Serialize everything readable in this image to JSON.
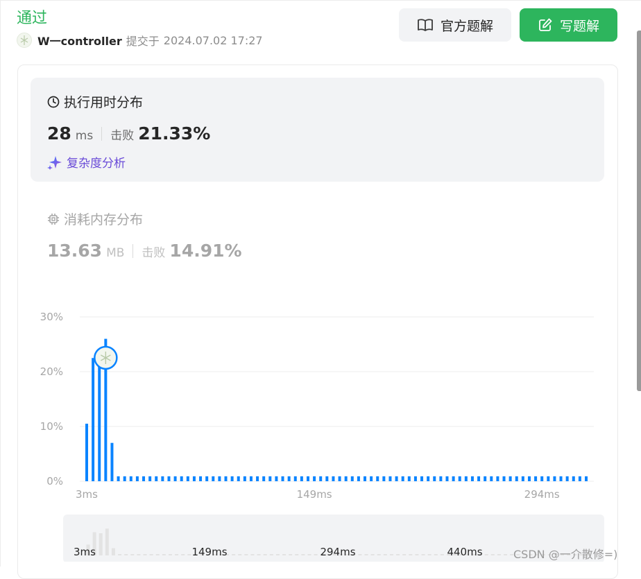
{
  "result": {
    "status": "通过"
  },
  "submission": {
    "username": "W一controller",
    "submitted_label": "提交于",
    "time": "2024.07.02 17:27"
  },
  "buttons": {
    "official_solution": "官方题解",
    "write_solution": "写题解"
  },
  "runtime": {
    "title": "执行用时分布",
    "value": "28",
    "unit": "ms",
    "beat_label": "击败",
    "beat_pct": "21.33%",
    "analysis_link": "复杂度分析"
  },
  "memory": {
    "title": "消耗内存分布",
    "value": "13.63",
    "unit": "MB",
    "beat_label": "击败",
    "beat_pct": "14.91%"
  },
  "colors": {
    "accent_green": "#2db55d",
    "bar_blue": "#0a84ff",
    "ai_purple": "#6a4bd8"
  },
  "chart_data": {
    "type": "bar",
    "ylim": [
      0,
      30
    ],
    "y_ticks": [
      "30%",
      "20%",
      "10%",
      "0%"
    ],
    "x_ticks": [
      "3ms",
      "149ms",
      "294ms",
      "440ms"
    ],
    "values": [
      10.5,
      22.5,
      21.5,
      26.0,
      7.0,
      0.9,
      0.9,
      0.9,
      0.9,
      0.9,
      0.9,
      0.9,
      0.9,
      0.9,
      0.9,
      0.9,
      0.9,
      0.9,
      0.9,
      0.9,
      0.9,
      0.9,
      0.9,
      0.9,
      0.9,
      0.9,
      0.9,
      0.9,
      0.9,
      0.9,
      0.9,
      0.9,
      0.9,
      0.9,
      0.9,
      0.9,
      0.9,
      0.9,
      0.9,
      0.9,
      0.9,
      0.9,
      0.9,
      0.9,
      0.9,
      0.9,
      0.9,
      0.9,
      0.9,
      0.9,
      0.9,
      0.9,
      0.9,
      0.9,
      0.9,
      0.9,
      0.9,
      0.9,
      0.9,
      0.9,
      0.9,
      0.9,
      0.9,
      0.9,
      0.9,
      0.9,
      0.9,
      0.9,
      0.9,
      0.9,
      0.9,
      0.9,
      0.9,
      0.9,
      0.9,
      0.9,
      0.9,
      0.9,
      0.9,
      0.9
    ],
    "highlight_index": 3,
    "grid": true,
    "overview_ticks": [
      "3ms",
      "149ms",
      "294ms",
      "440ms"
    ]
  },
  "watermark": "CSDN @一介散修=)"
}
